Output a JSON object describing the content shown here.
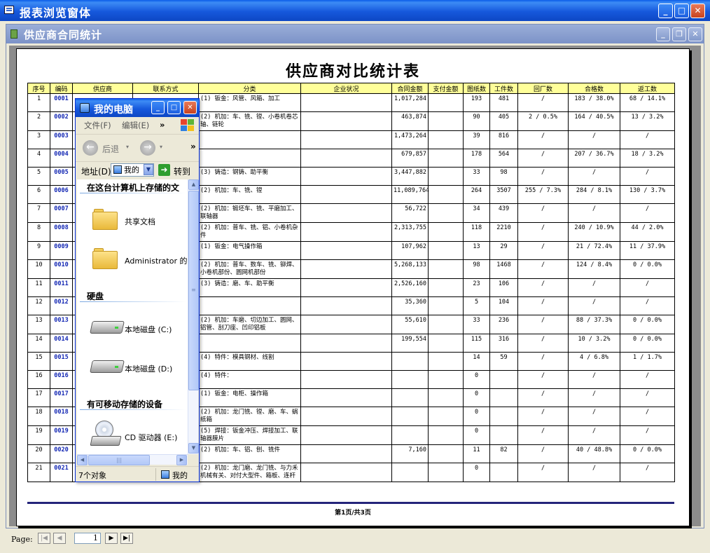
{
  "app": {
    "title": "报表浏览窗体"
  },
  "child": {
    "title": "供应商合同统计"
  },
  "report": {
    "title": "供应商对比统计表",
    "columns": [
      "序号",
      "编码",
      "供应商",
      "联系方式",
      "分类",
      "企业状况",
      "合同金额",
      "支付金额",
      "图纸数",
      "工件数",
      "回厂数",
      "合格数",
      "返工数"
    ],
    "rows": [
      [
        "1",
        "0001",
        "",
        "",
        "(1) 钣金：风管、风箱、加工",
        "",
        "1,017,284",
        "",
        "193",
        "481",
        "/",
        "183 / 38.0%",
        "68 / 14.1%"
      ],
      [
        "2",
        "0002",
        "",
        "",
        "(2) 机加：车、铣、镗、小卷机卷芯轴、链轮",
        "",
        "463,874",
        "",
        "90",
        "405",
        "2 / 0.5%",
        "164 / 40.5%",
        "13 / 3.2%"
      ],
      [
        "3",
        "0003",
        "",
        "",
        "",
        "",
        "1,473,264",
        "",
        "39",
        "816",
        "/",
        "/",
        "/"
      ],
      [
        "4",
        "0004",
        "",
        "",
        "",
        "",
        "679,857",
        "",
        "178",
        "564",
        "/",
        "207 / 36.7%",
        "18 / 3.2%"
      ],
      [
        "5",
        "0005",
        "",
        "",
        "(3) 铸造：钢铸、助平衡",
        "",
        "3,447,882",
        "",
        "33",
        "98",
        "/",
        "/",
        "/"
      ],
      [
        "6",
        "0006",
        "",
        "",
        "(2) 机加：车、铣、镗",
        "",
        "11,089,764",
        "",
        "264",
        "3507",
        "255 / 7.3%",
        "284 / 8.1%",
        "130 / 3.7%"
      ],
      [
        "7",
        "0007",
        "",
        "",
        "(2) 机加：锻坯车、铣、平磨加工、联轴器",
        "",
        "56,722",
        "",
        "34",
        "439",
        "/",
        "/",
        "/"
      ],
      [
        "8",
        "0008",
        "",
        "",
        "(2) 机加：普车、铣、铝、小卷机杂件",
        "",
        "2,313,755",
        "",
        "118",
        "2210",
        "/",
        "240 / 10.9%",
        "44 / 2.0%"
      ],
      [
        "9",
        "0009",
        "",
        "",
        "(1) 钣金：电气操作箱",
        "",
        "107,962",
        "",
        "13",
        "29",
        "/",
        "21 / 72.4%",
        "11 / 37.9%"
      ],
      [
        "10",
        "0010",
        "",
        "",
        "(2) 机加：普车、数车、铣、铆焊、小卷机部份、圆网机部份",
        "",
        "5,268,133",
        "",
        "98",
        "1468",
        "/",
        "124 / 8.4%",
        "0 / 0.0%"
      ],
      [
        "11",
        "0011",
        "",
        "",
        "(3) 铸造：磨、车、助平衡",
        "",
        "2,526,160",
        "",
        "23",
        "106",
        "/",
        "/",
        "/"
      ],
      [
        "12",
        "0012",
        "",
        "",
        "",
        "",
        "35,360",
        "",
        "5",
        "104",
        "/",
        "/",
        "/"
      ],
      [
        "13",
        "0013",
        "",
        "",
        "(2) 机加：车磨、切边加工、圆网、铝管、刮刀座、凹印铝板",
        "",
        "55,610",
        "",
        "33",
        "236",
        "/",
        "88 / 37.3%",
        "0 / 0.0%"
      ],
      [
        "14",
        "0014",
        "",
        "",
        "",
        "",
        "199,554",
        "",
        "115",
        "316",
        "/",
        "10 / 3.2%",
        "0 / 0.0%"
      ],
      [
        "15",
        "0015",
        "",
        "",
        "(4) 特件：模具钢材、线割",
        "",
        "",
        "",
        "14",
        "59",
        "/",
        "4 / 6.8%",
        "1 / 1.7%"
      ],
      [
        "16",
        "0016",
        "",
        "",
        "(4) 特件：",
        "",
        "",
        "",
        "0",
        "",
        "/",
        "/",
        "/"
      ],
      [
        "17",
        "0017",
        "",
        "",
        "(1) 钣金：电柜、操作箱",
        "",
        "",
        "",
        "0",
        "",
        "/",
        "/",
        "/"
      ],
      [
        "18",
        "0018",
        "",
        "",
        "(2) 机加：龙门铣、镗、磨、车、蜗纸箱",
        "",
        "",
        "",
        "0",
        "",
        "/",
        "/",
        "/"
      ],
      [
        "19",
        "0019",
        "",
        "",
        "(5) 焊接：钣金冲压、焊接加工、联轴器膜片",
        "",
        "",
        "",
        "0",
        "",
        "/",
        "/",
        "/"
      ],
      [
        "20",
        "0020",
        "",
        "",
        "(2) 机加：车、铝、刨、铣件",
        "",
        "7,160",
        "",
        "11",
        "82",
        "/",
        "40 / 48.8%",
        "0 / 0.0%"
      ],
      [
        "21",
        "0021",
        "",
        "",
        "(2) 机加：龙门磨、龙门铣、与力禾机械有关、对付大型件、箱板、连杆",
        "",
        "",
        "",
        "0",
        "",
        "/",
        "/",
        "/"
      ]
    ],
    "page_info": "第1页/共3页"
  },
  "navbar": {
    "label": "Page:",
    "page": "1"
  },
  "mycomputer": {
    "title": "我的电脑",
    "menu": {
      "file": "文件(F)",
      "edit": "编辑(E)",
      "more": "»"
    },
    "toolbar": {
      "back": "后退",
      "more": "»"
    },
    "address": {
      "label": "地址(D)",
      "value": "我的",
      "go": "转到"
    },
    "groups": {
      "files": "在这台计算机上存储的文",
      "disks": "硬盘",
      "removable": "有可移动存储的设备"
    },
    "items": {
      "shared": "共享文档",
      "admin": "Administrator 的文",
      "c": "本地磁盘 (C:)",
      "d": "本地磁盘 (D:)",
      "cd": "CD 驱动器 (E:)"
    },
    "status": {
      "count": "7个对象",
      "location": "我的"
    }
  }
}
